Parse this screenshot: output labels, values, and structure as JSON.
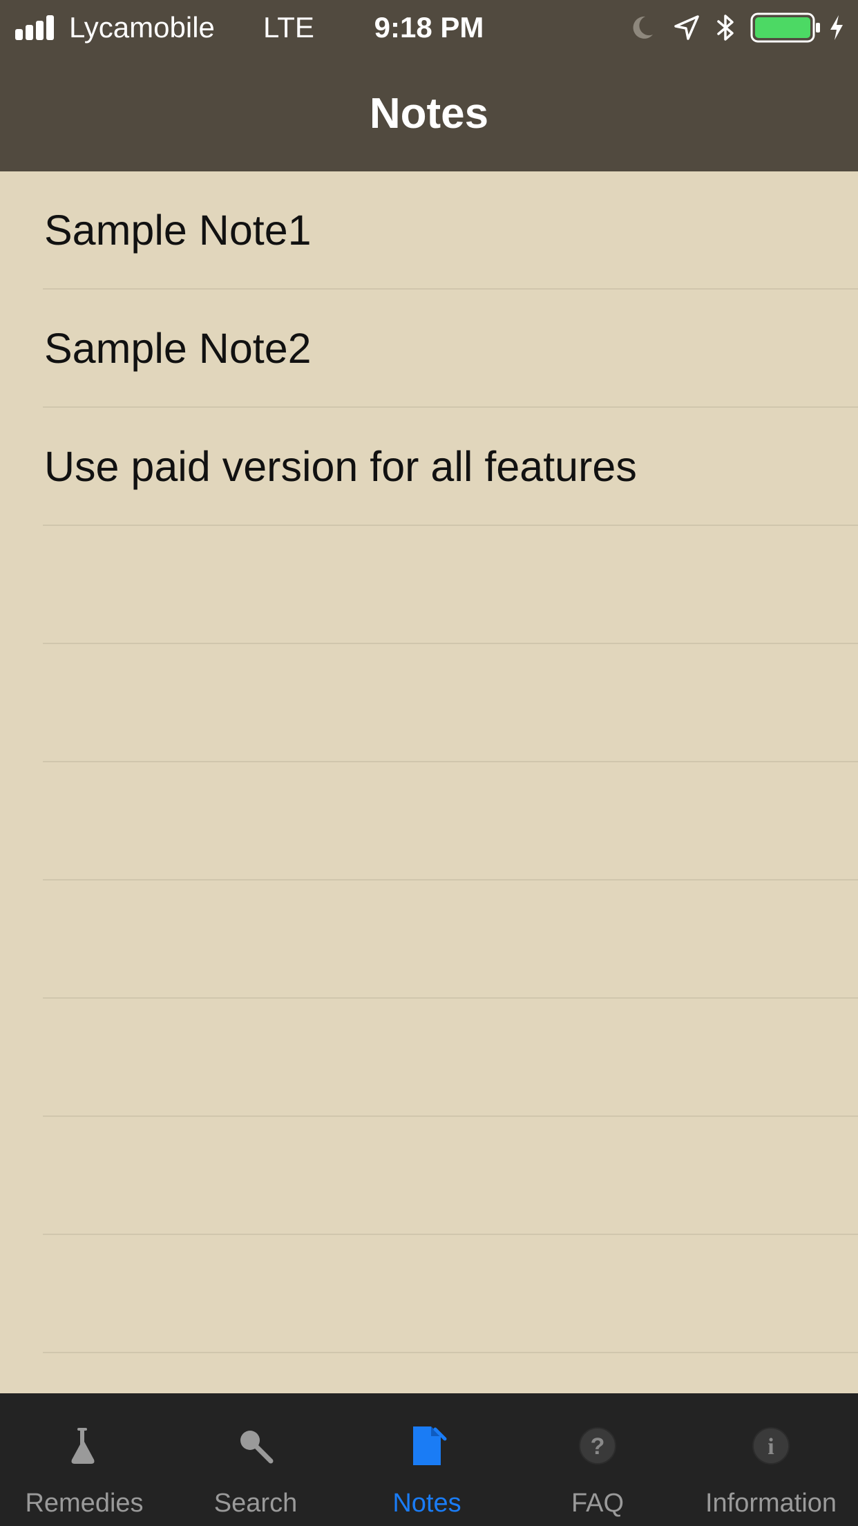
{
  "status_bar": {
    "carrier": "Lycamobile",
    "network": "LTE",
    "time": "9:18 PM",
    "battery_color": "#4cd964",
    "icons": [
      "signal-bars-icon",
      "moon-icon",
      "location-arrow-icon",
      "bluetooth-icon",
      "battery-icon",
      "charging-bolt-icon"
    ]
  },
  "nav": {
    "title": "Notes"
  },
  "notes": {
    "items": [
      {
        "label": "Sample Note1"
      },
      {
        "label": "Sample Note2"
      },
      {
        "label": "Use paid version for all features"
      },
      {
        "label": ""
      },
      {
        "label": ""
      },
      {
        "label": ""
      },
      {
        "label": ""
      },
      {
        "label": ""
      },
      {
        "label": ""
      },
      {
        "label": ""
      }
    ]
  },
  "tabbar": {
    "active_color": "#1a7cf5",
    "inactive_color": "#9a9a9a",
    "tabs": [
      {
        "label": "Remedies",
        "icon": "flask-icon"
      },
      {
        "label": "Search",
        "icon": "magnifier-icon"
      },
      {
        "label": "Notes",
        "icon": "note-icon",
        "active": true
      },
      {
        "label": "FAQ",
        "icon": "question-icon"
      },
      {
        "label": "Information",
        "icon": "info-icon"
      }
    ]
  },
  "colors": {
    "header_bg": "#514a3f",
    "list_bg": "#e1d6bc",
    "separator": "#d0c6ad",
    "tabbar_bg": "#232323"
  }
}
